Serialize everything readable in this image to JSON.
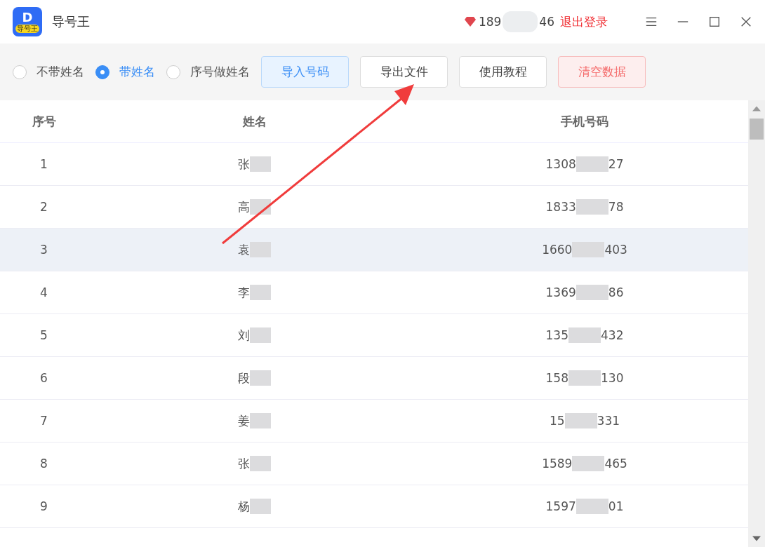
{
  "app": {
    "logo_letter": "D",
    "logo_badge": "导号王",
    "title": "导号王"
  },
  "account": {
    "phone_start": "189",
    "phone_end": "46",
    "logout": "退出登录"
  },
  "modes": [
    {
      "label": "不带姓名",
      "selected": false
    },
    {
      "label": "带姓名",
      "selected": true
    },
    {
      "label": "序号做姓名",
      "selected": false
    }
  ],
  "buttons": [
    {
      "label": "导入号码",
      "kind": "primary"
    },
    {
      "label": "导出文件",
      "kind": "default"
    },
    {
      "label": "使用教程",
      "kind": "default"
    },
    {
      "label": "清空数据",
      "kind": "danger"
    }
  ],
  "table": {
    "columns": [
      "序号",
      "姓名",
      "手机号码"
    ],
    "rows": [
      {
        "index": "1",
        "name": "张",
        "phone_start": "1308",
        "phone_end": "27",
        "selected": false
      },
      {
        "index": "2",
        "name": "高",
        "phone_start": "1833",
        "phone_end": "78",
        "selected": false
      },
      {
        "index": "3",
        "name": "袁",
        "phone_start": "1660",
        "phone_end": "403",
        "selected": true
      },
      {
        "index": "4",
        "name": "李",
        "phone_start": "1369",
        "phone_end": "86",
        "selected": false
      },
      {
        "index": "5",
        "name": "刘",
        "phone_start": "135",
        "phone_end": "432",
        "selected": false
      },
      {
        "index": "6",
        "name": "段",
        "phone_start": "158",
        "phone_end": "130",
        "selected": false
      },
      {
        "index": "7",
        "name": "姜",
        "phone_start": "15",
        "phone_end": "331",
        "selected": false
      },
      {
        "index": "8",
        "name": "张",
        "phone_start": "1589",
        "phone_end": "465",
        "selected": false
      },
      {
        "index": "9",
        "name": "杨",
        "phone_start": "1597",
        "phone_end": "01",
        "selected": false
      }
    ]
  }
}
